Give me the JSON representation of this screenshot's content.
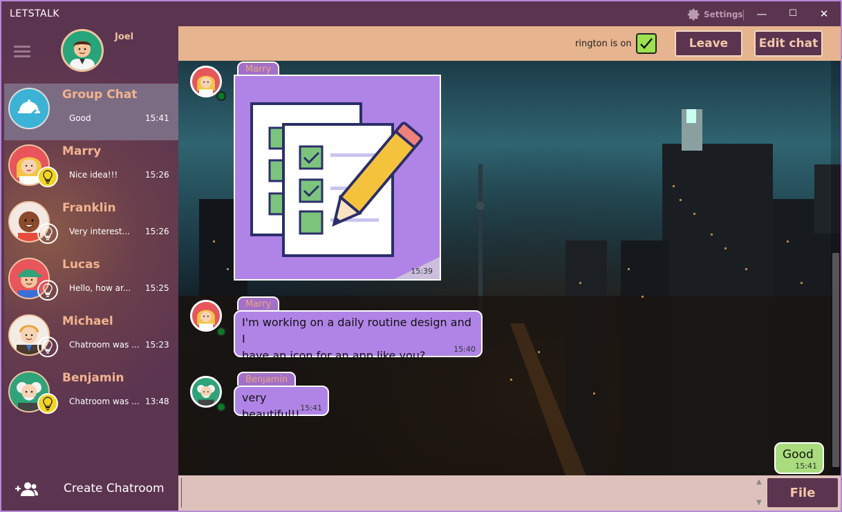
{
  "window": {
    "title": "LETSTALK",
    "settings_label": "Settings",
    "minimize": "—",
    "maximize": "☐",
    "close": "✕"
  },
  "user": {
    "name": "Joel"
  },
  "sidebar": {
    "chats": [
      {
        "name": "Group Chat",
        "preview": "Good",
        "time": "15:41"
      },
      {
        "name": "Marry",
        "preview": "Nice idea!!!",
        "time": "15:26"
      },
      {
        "name": "Franklin",
        "preview": "Very interest...",
        "time": "15:26"
      },
      {
        "name": "Lucas",
        "preview": "Hello, how ar...",
        "time": "15:25"
      },
      {
        "name": "Michael",
        "preview": "Chatroom was ...",
        "time": "15:23"
      },
      {
        "name": "Benjamin",
        "preview": "Chatroom was ...",
        "time": "13:48"
      }
    ],
    "create_label": "Create Chatroom"
  },
  "topbar": {
    "ringtone_label": "rington is on",
    "ringtone_on": true,
    "leave_label": "Leave",
    "edit_label": "Edit chat"
  },
  "messages": [
    {
      "sender": "Marry",
      "type": "image",
      "time": "15:39"
    },
    {
      "sender": "Marry",
      "text": "I'm working on a daily routine design and I have an icon for an app like you?",
      "line1": "I'm working on a daily routine design and I",
      "line2": "have an icon for an app like you?",
      "time": "15:40"
    },
    {
      "sender": "Benjamin",
      "text": "very beautiful!!",
      "time": "15:41"
    },
    {
      "sender": "Joel",
      "text": "Good",
      "time": "15:41",
      "own": true
    }
  ],
  "composer": {
    "placeholder": "",
    "file_label": "File"
  },
  "colors": {
    "brand": "#5b3450",
    "accent": "#e6b48e",
    "bubble": "#b084e6",
    "own_bubble": "#a9dc7c"
  }
}
